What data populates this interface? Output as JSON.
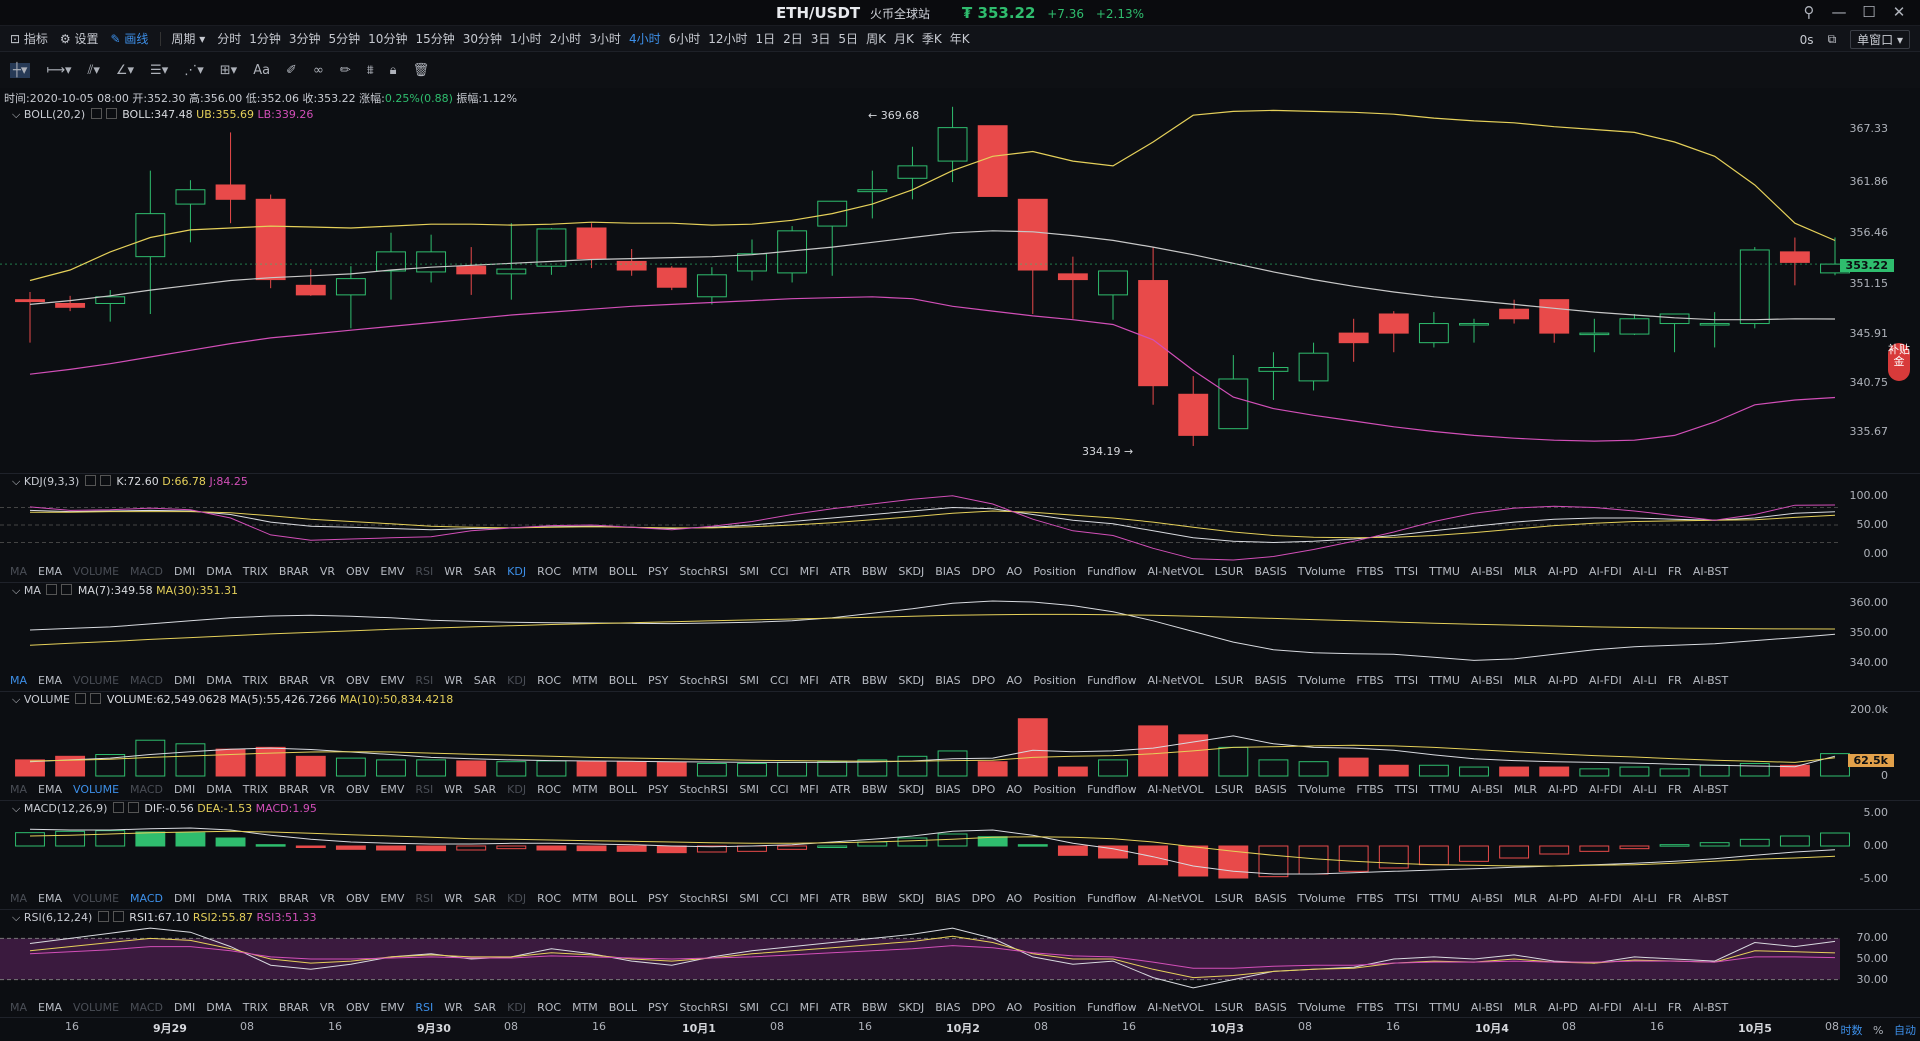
{
  "header": {
    "symbol": "ETH/USDT",
    "exchange": "火币全球站",
    "price": "₮ 353.22",
    "change": "+7.36",
    "change_pct": "+2.13%"
  },
  "toolbar": {
    "indicators": "指标",
    "settings": "设置",
    "draw": "画线",
    "period": "周期",
    "timeframes": [
      "分时",
      "1分钟",
      "3分钟",
      "5分钟",
      "10分钟",
      "15分钟",
      "30分钟",
      "1小时",
      "2小时",
      "3小时",
      "4小时",
      "6小时",
      "12小时",
      "1日",
      "2日",
      "3日",
      "5日",
      "周K",
      "月K",
      "季K",
      "年K"
    ],
    "active_tf": "4小时",
    "right_time": "0s",
    "window": "单窗口"
  },
  "info": {
    "time": "时间:2020-10-05 08:00",
    "open": "开:352.30",
    "high": "高:356.00",
    "low": "低:352.06",
    "close": "收:353.22",
    "chg_label": "涨幅:",
    "chg_val": "0.25%(0.88)",
    "amp": "振幅:1.12%"
  },
  "boll": {
    "name": "BOLL(20,2)",
    "mid": "BOLL:347.48",
    "ub": "UB:355.69",
    "lb": "LB:339.26"
  },
  "kdj": {
    "name": "KDJ(9,3,3)",
    "k": "K:72.60",
    "d": "D:66.78",
    "j": "J:84.25"
  },
  "ma": {
    "name": "MA",
    "ma7": "MA(7):349.58",
    "ma30": "MA(30):351.31"
  },
  "volume": {
    "name": "VOLUME",
    "vol": "VOLUME:62,549.0628",
    "ma5": "MA(5):55,426.7266",
    "ma10": "MA(10):50,834.4218"
  },
  "macd": {
    "name": "MACD(12,26,9)",
    "dif": "DIF:-0.56",
    "dea": "DEA:-1.53",
    "macd": "MACD:1.95"
  },
  "rsi": {
    "name": "RSI(6,12,24)",
    "r1": "RSI1:67.10",
    "r2": "RSI2:55.87",
    "r3": "RSI3:51.33"
  },
  "tabs": [
    "MA",
    "EMA",
    "VOLUME",
    "MACD",
    "DMI",
    "DMA",
    "TRIX",
    "BRAR",
    "VR",
    "OBV",
    "EMV",
    "RSI",
    "WR",
    "SAR",
    "KDJ",
    "ROC",
    "MTM",
    "BOLL",
    "PSY",
    "StochRSI",
    "SMI",
    "CCI",
    "MFI",
    "ATR",
    "BBW",
    "SKDJ",
    "BIAS",
    "DPO",
    "AO",
    "Position",
    "Fundflow",
    "AI-NetVOL",
    "LSUR",
    "BASIS",
    "TVolume",
    "FTBS",
    "TTSI",
    "TTMU",
    "AI-BSI",
    "MLR",
    "AI-PD",
    "AI-FDI",
    "AI-LI",
    "FR",
    "AI-BST"
  ],
  "axes": {
    "price": [
      "367.33",
      "361.86",
      "356.46",
      "351.15",
      "345.91",
      "340.75",
      "335.67"
    ],
    "kdj": [
      "100.00",
      "50.00",
      "0.00"
    ],
    "ma": [
      "360.00",
      "350.00",
      "340.00"
    ],
    "vol": [
      "200.0k",
      "0"
    ],
    "macd": [
      "5.00",
      "0.00",
      "-5.00"
    ],
    "rsi": [
      "70.00",
      "50.00",
      "30.00"
    ],
    "last_price": "353.22",
    "last_vol": "62.5k"
  },
  "annotations": {
    "high": "← 369.68",
    "low": "334.19 →"
  },
  "badge": "补贴金",
  "xaxis": [
    [
      "16",
      ""
    ],
    [
      "9月29",
      "b"
    ],
    [
      "08",
      ""
    ],
    [
      "16",
      ""
    ],
    [
      "9月30",
      "b"
    ],
    [
      "08",
      ""
    ],
    [
      "16",
      ""
    ],
    [
      "10月1",
      "b"
    ],
    [
      "08",
      ""
    ],
    [
      "16",
      ""
    ],
    [
      "10月2",
      "b"
    ],
    [
      "08",
      ""
    ],
    [
      "16",
      ""
    ],
    [
      "10月3",
      "b"
    ],
    [
      "08",
      ""
    ],
    [
      "16",
      ""
    ],
    [
      "10月4",
      "b"
    ],
    [
      "08",
      ""
    ],
    [
      "16",
      ""
    ],
    [
      "10月5",
      "b"
    ],
    [
      "08",
      ""
    ]
  ],
  "corner": {
    "time": "时数",
    "pct": "%",
    "auto": "自动"
  },
  "chart_data": {
    "type": "candlestick",
    "candles": [
      [
        349.5,
        350.3,
        345.0,
        349.3
      ],
      [
        349.1,
        349.9,
        348.3,
        348.7
      ],
      [
        349.1,
        350.5,
        347.2,
        349.8
      ],
      [
        354.0,
        363.0,
        348.0,
        358.5
      ],
      [
        359.5,
        362.0,
        355.5,
        361.0
      ],
      [
        361.5,
        367.0,
        357.5,
        360.0
      ],
      [
        360.0,
        360.5,
        350.7,
        351.6
      ],
      [
        351.0,
        352.7,
        349.9,
        350.0
      ],
      [
        350.0,
        353.0,
        346.5,
        351.7
      ],
      [
        352.5,
        356.5,
        349.5,
        354.5
      ],
      [
        352.4,
        356.3,
        351.3,
        354.5
      ],
      [
        353.0,
        355.0,
        350.0,
        352.2
      ],
      [
        352.2,
        357.5,
        349.5,
        352.7
      ],
      [
        353.0,
        357.0,
        352.1,
        356.9
      ],
      [
        357.0,
        357.5,
        352.8,
        353.8
      ],
      [
        353.5,
        354.8,
        352.0,
        352.6
      ],
      [
        352.8,
        353.0,
        350.5,
        350.8
      ],
      [
        349.8,
        352.9,
        349.0,
        352.1
      ],
      [
        352.5,
        355.8,
        351.5,
        354.3
      ],
      [
        352.3,
        357.2,
        351.3,
        356.7
      ],
      [
        357.2,
        359.0,
        352.0,
        359.8
      ],
      [
        360.8,
        363.0,
        358.0,
        361.0
      ],
      [
        362.2,
        365.5,
        360.0,
        363.5
      ],
      [
        364.0,
        369.68,
        361.8,
        367.5
      ],
      [
        367.7,
        367.7,
        361.3,
        360.3
      ],
      [
        360.0,
        360.0,
        348.0,
        352.6
      ],
      [
        352.2,
        354.0,
        347.5,
        351.6
      ],
      [
        350.0,
        352.5,
        347.4,
        352.5
      ],
      [
        351.5,
        355.0,
        338.5,
        340.5
      ],
      [
        339.6,
        341.5,
        334.19,
        335.3
      ],
      [
        336.0,
        343.7,
        336.3,
        341.2
      ],
      [
        342.0,
        344.0,
        339.0,
        342.4
      ],
      [
        341.0,
        345.0,
        340.0,
        343.9
      ],
      [
        346.0,
        347.5,
        343.0,
        345.0
      ],
      [
        348.0,
        348.3,
        344.0,
        346.0
      ],
      [
        345.0,
        348.2,
        344.5,
        347.0
      ],
      [
        347.0,
        347.5,
        345.0,
        347.0
      ],
      [
        348.5,
        349.5,
        347.0,
        347.5
      ],
      [
        349.5,
        349.0,
        345.0,
        346.0
      ],
      [
        346.0,
        347.5,
        344.0,
        346.0
      ],
      [
        345.9,
        348.0,
        345.8,
        347.5
      ],
      [
        347.0,
        348.0,
        344.0,
        348.0
      ],
      [
        347.0,
        348.2,
        344.5,
        347.0
      ],
      [
        347.0,
        355.0,
        346.5,
        354.7
      ],
      [
        354.5,
        356.0,
        351.0,
        353.4
      ],
      [
        352.3,
        356.0,
        352.06,
        353.22
      ]
    ],
    "boll_ub": [
      351.5,
      352.6,
      354.5,
      356.0,
      356.8,
      357.0,
      357.2,
      357.1,
      357.0,
      357.2,
      357.4,
      357.4,
      357.3,
      357.4,
      357.6,
      357.5,
      357.5,
      357.3,
      357.4,
      357.8,
      358.5,
      359.5,
      361.0,
      363.0,
      364.5,
      365.0,
      364.0,
      363.5,
      366.0,
      368.8,
      369.2,
      369.3,
      369.2,
      369.1,
      368.9,
      368.5,
      368.2,
      368.0,
      367.6,
      367.3,
      367.0,
      366.0,
      364.5,
      361.5,
      357.5,
      355.69
    ],
    "boll_mid": [
      349.0,
      349.4,
      349.9,
      350.5,
      351.0,
      351.5,
      351.8,
      352.0,
      352.2,
      352.6,
      352.9,
      353.1,
      353.3,
      353.5,
      353.7,
      353.8,
      353.9,
      354.0,
      354.2,
      354.6,
      355.0,
      355.5,
      356.0,
      356.5,
      356.7,
      356.6,
      356.2,
      355.7,
      355.0,
      354.2,
      353.3,
      352.4,
      351.6,
      350.9,
      350.3,
      349.8,
      349.4,
      349.0,
      348.6,
      348.2,
      347.9,
      347.6,
      347.4,
      347.4,
      347.5,
      347.48
    ],
    "boll_lb": [
      341.7,
      342.2,
      342.8,
      343.5,
      344.2,
      344.9,
      345.5,
      345.9,
      346.3,
      346.7,
      347.1,
      347.5,
      347.9,
      348.2,
      348.5,
      348.8,
      349.0,
      349.2,
      349.4,
      349.6,
      349.7,
      349.8,
      349.6,
      348.8,
      348.3,
      347.8,
      347.4,
      346.9,
      345.3,
      342.1,
      339.3,
      338.1,
      337.4,
      336.8,
      336.2,
      335.7,
      335.3,
      335.0,
      334.8,
      334.7,
      334.8,
      335.3,
      336.7,
      338.5,
      339.0,
      339.26
    ],
    "kdj_k": [
      75,
      73,
      74,
      75,
      74,
      68,
      55,
      48,
      46,
      44,
      42,
      44,
      45,
      47,
      48,
      46,
      44,
      46,
      50,
      56,
      62,
      68,
      74,
      80,
      78,
      68,
      58,
      52,
      40,
      28,
      22,
      20,
      22,
      26,
      32,
      40,
      48,
      55,
      60,
      62,
      62,
      60,
      58,
      62,
      70,
      72.6
    ],
    "kdj_d": [
      72,
      72,
      73,
      73,
      73,
      71,
      66,
      60,
      56,
      52,
      48,
      46,
      45,
      46,
      47,
      46,
      45,
      45,
      47,
      50,
      54,
      59,
      64,
      70,
      74,
      72,
      67,
      62,
      55,
      46,
      38,
      32,
      29,
      28,
      29,
      32,
      37,
      43,
      49,
      53,
      56,
      57,
      58,
      59,
      63,
      66.78
    ],
    "kdj_j": [
      81,
      75,
      76,
      79,
      76,
      62,
      33,
      24,
      26,
      28,
      30,
      40,
      45,
      49,
      50,
      46,
      42,
      48,
      56,
      68,
      78,
      86,
      94,
      100,
      86,
      60,
      40,
      32,
      10,
      -8,
      -10,
      -4,
      8,
      22,
      38,
      56,
      70,
      79,
      82,
      80,
      74,
      66,
      58,
      68,
      84,
      84.25
    ],
    "ma7": [
      351.0,
      351.5,
      352.0,
      353.0,
      354.0,
      355.0,
      355.6,
      355.8,
      355.5,
      355.0,
      354.2,
      353.8,
      353.5,
      353.4,
      353.3,
      353.2,
      353.1,
      353.3,
      353.5,
      354.0,
      355.0,
      356.5,
      358.0,
      359.8,
      360.5,
      360.2,
      359.0,
      357.0,
      354.0,
      350.5,
      347.0,
      344.5,
      343.5,
      343.2,
      343.0,
      342.0,
      341.0,
      341.5,
      343.0,
      344.5,
      345.5,
      346.0,
      346.5,
      347.5,
      348.5,
      349.58
    ],
    "ma30": [
      346.0,
      346.6,
      347.2,
      347.9,
      348.5,
      349.1,
      349.7,
      350.2,
      350.7,
      351.2,
      351.6,
      352.0,
      352.4,
      352.8,
      353.1,
      353.4,
      353.7,
      354.0,
      354.3,
      354.6,
      354.9,
      355.2,
      355.5,
      355.8,
      356.0,
      356.1,
      356.1,
      356.0,
      355.8,
      355.5,
      355.2,
      354.8,
      354.4,
      354.0,
      353.6,
      353.2,
      352.9,
      352.6,
      352.3,
      352.0,
      351.8,
      351.6,
      351.5,
      351.4,
      351.35,
      351.31
    ],
    "volume": [
      45,
      55,
      60,
      100,
      90,
      75,
      80,
      55,
      50,
      45,
      45,
      42,
      40,
      42,
      40,
      40,
      38,
      35,
      35,
      38,
      40,
      45,
      55,
      70,
      40,
      160,
      25,
      45,
      140,
      115,
      80,
      45,
      40,
      50,
      30,
      30,
      25,
      25,
      25,
      20,
      25,
      20,
      30,
      35,
      30,
      62.5
    ],
    "vol_ma5": [
      40,
      45,
      50,
      60,
      68,
      75,
      78,
      74,
      67,
      60,
      52,
      48,
      45,
      43,
      42,
      41,
      40,
      39,
      38,
      38,
      38,
      39,
      42,
      48,
      50,
      72,
      68,
      70,
      78,
      95,
      112,
      90,
      80,
      78,
      72,
      59,
      48,
      43,
      40,
      38,
      36,
      33,
      30,
      28,
      26,
      55.4
    ],
    "vol_ma10": [
      42,
      44,
      47,
      52,
      56,
      60,
      64,
      67,
      68,
      67,
      64,
      61,
      58,
      55,
      52,
      50,
      48,
      46,
      44,
      43,
      42,
      41,
      41,
      43,
      44,
      52,
      55,
      57,
      62,
      70,
      80,
      82,
      84,
      86,
      84,
      80,
      74,
      68,
      62,
      57,
      53,
      48,
      44,
      41,
      38,
      50.8
    ],
    "macd_hist": [
      2.0,
      2.2,
      2.3,
      2.1,
      2.0,
      1.2,
      0.2,
      -0.2,
      -0.5,
      -0.6,
      -0.7,
      -0.6,
      -0.4,
      -0.6,
      -0.7,
      -0.8,
      -1.0,
      -0.9,
      -0.8,
      -0.5,
      0.0,
      0.6,
      1.2,
      1.8,
      1.4,
      0.2,
      -1.4,
      -1.8,
      -2.8,
      -4.5,
      -4.8,
      -4.6,
      -4.2,
      -3.8,
      -3.3,
      -2.8,
      -2.3,
      -1.8,
      -1.2,
      -0.8,
      -0.4,
      0.2,
      0.5,
      1.0,
      1.5,
      1.95
    ],
    "macd_dif": [
      2.5,
      2.4,
      2.4,
      2.6,
      2.7,
      2.4,
      1.6,
      1.0,
      0.6,
      0.4,
      0.3,
      0.3,
      0.4,
      0.4,
      0.3,
      0.2,
      0.0,
      -0.1,
      0.0,
      0.2,
      0.6,
      1.0,
      1.5,
      2.2,
      2.4,
      1.6,
      0.4,
      -0.4,
      -1.6,
      -3.0,
      -3.8,
      -4.2,
      -4.2,
      -4.0,
      -3.8,
      -3.6,
      -3.4,
      -3.2,
      -3.0,
      -2.8,
      -2.6,
      -2.3,
      -1.9,
      -1.4,
      -0.9,
      -0.56
    ],
    "macd_dea": [
      1.5,
      1.6,
      1.8,
      2.0,
      2.1,
      2.2,
      2.1,
      1.9,
      1.7,
      1.5,
      1.3,
      1.1,
      1.0,
      0.9,
      0.8,
      0.7,
      0.6,
      0.5,
      0.4,
      0.4,
      0.5,
      0.6,
      0.8,
      1.0,
      1.3,
      1.4,
      1.3,
      1.1,
      0.6,
      -0.1,
      -0.8,
      -1.4,
      -1.9,
      -2.3,
      -2.6,
      -2.8,
      -2.9,
      -3.0,
      -3.0,
      -2.9,
      -2.8,
      -2.6,
      -2.3,
      -2.0,
      -1.8,
      -1.53
    ],
    "rsi1": [
      65,
      70,
      75,
      80,
      76,
      62,
      44,
      40,
      45,
      52,
      55,
      50,
      52,
      60,
      55,
      48,
      44,
      52,
      58,
      62,
      66,
      70,
      74,
      80,
      70,
      52,
      45,
      48,
      32,
      22,
      30,
      38,
      40,
      42,
      50,
      52,
      50,
      54,
      48,
      46,
      52,
      50,
      48,
      66,
      62,
      67.1
    ],
    "rsi2": [
      58,
      62,
      66,
      70,
      68,
      60,
      50,
      46,
      48,
      52,
      54,
      52,
      52,
      56,
      54,
      50,
      48,
      51,
      55,
      58,
      61,
      64,
      67,
      72,
      66,
      55,
      50,
      50,
      40,
      32,
      34,
      38,
      40,
      41,
      46,
      48,
      47,
      50,
      47,
      46,
      49,
      48,
      47,
      58,
      57,
      55.87
    ],
    "rsi3": [
      55,
      57,
      59,
      62,
      62,
      58,
      52,
      50,
      50,
      51,
      52,
      51,
      51,
      53,
      52,
      51,
      50,
      51,
      52,
      54,
      56,
      58,
      60,
      63,
      61,
      56,
      53,
      52,
      47,
      41,
      41,
      43,
      44,
      44,
      46,
      47,
      47,
      48,
      47,
      47,
      48,
      48,
      47,
      52,
      52,
      51.33
    ]
  }
}
